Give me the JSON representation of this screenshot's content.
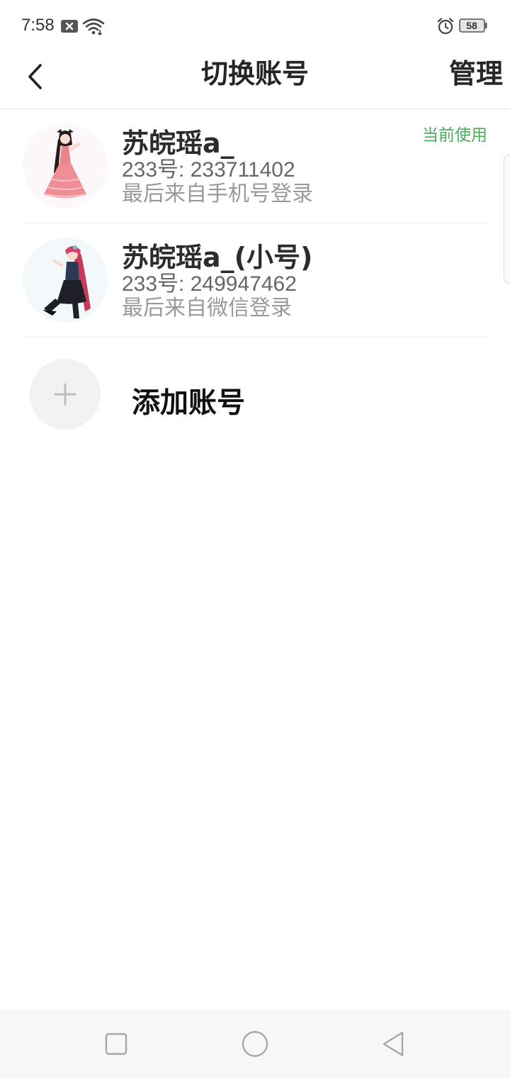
{
  "status_bar": {
    "time": "7:58",
    "battery": "58",
    "icons": [
      "notification-x-icon",
      "wifi-icon",
      "alarm-icon",
      "battery-icon"
    ]
  },
  "header": {
    "title": "切换账号",
    "manage_label": "管理",
    "back_icon": "chevron-left-icon"
  },
  "accounts": [
    {
      "name": "苏皖瑶a_",
      "id_text": "233号: 233711402",
      "login_text": "最后来自手机号登录",
      "badge": "当前使用"
    },
    {
      "name": "苏皖瑶a_(小号)",
      "id_text": "233号: 249947462",
      "login_text": "最后来自微信登录"
    }
  ],
  "add_account": {
    "label": "添加账号",
    "icon": "plus-icon"
  },
  "nav_bar": {
    "icons": [
      "recent-apps-icon",
      "home-icon",
      "back-triangle-icon"
    ]
  },
  "colors": {
    "accent_green": "#4caa5a",
    "title_text": "#262626",
    "secondary_text": "#666666",
    "muted_text": "#9a9a9a",
    "divider": "#ebebeb"
  }
}
